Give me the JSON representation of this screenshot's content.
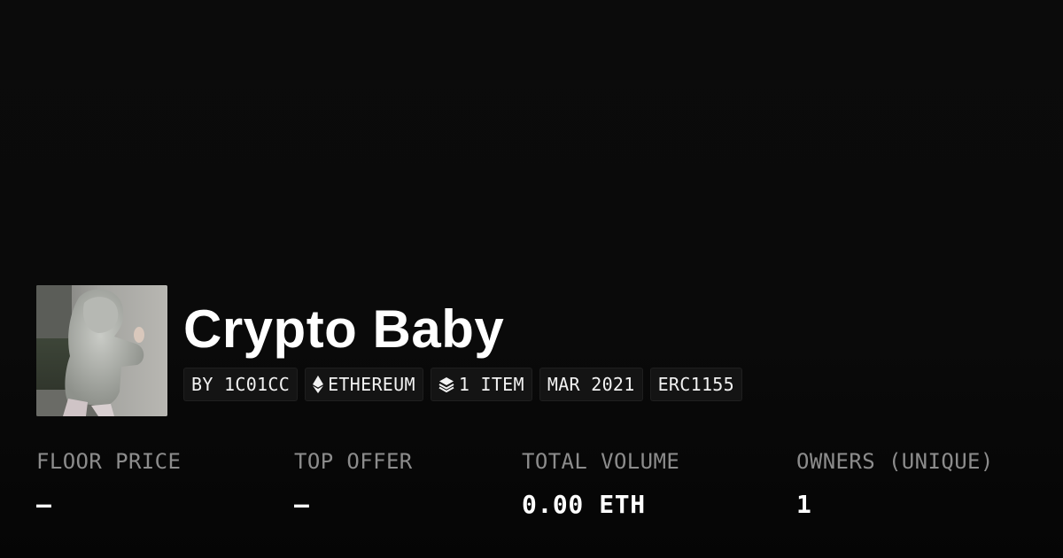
{
  "collection": {
    "title": "Crypto Baby",
    "avatar_alt": "collection-avatar"
  },
  "chips": [
    {
      "label": "BY 1C01CC",
      "icon": ""
    },
    {
      "label": "ETHEREUM",
      "icon": "ethereum-icon"
    },
    {
      "label": "1 ITEM",
      "icon": "layers-icon"
    },
    {
      "label": "MAR 2021",
      "icon": ""
    },
    {
      "label": "ERC1155",
      "icon": ""
    }
  ],
  "stats": [
    {
      "label": "FLOOR PRICE",
      "value": "–"
    },
    {
      "label": "TOP OFFER",
      "value": "–"
    },
    {
      "label": "TOTAL VOLUME",
      "value": "0.00 ETH"
    },
    {
      "label": "OWNERS (UNIQUE)",
      "value": "1"
    }
  ],
  "colors": {
    "background": "#0a0a0a",
    "text": "#ffffff",
    "muted": "#8c8c8c",
    "chip_bg": "#141414"
  }
}
